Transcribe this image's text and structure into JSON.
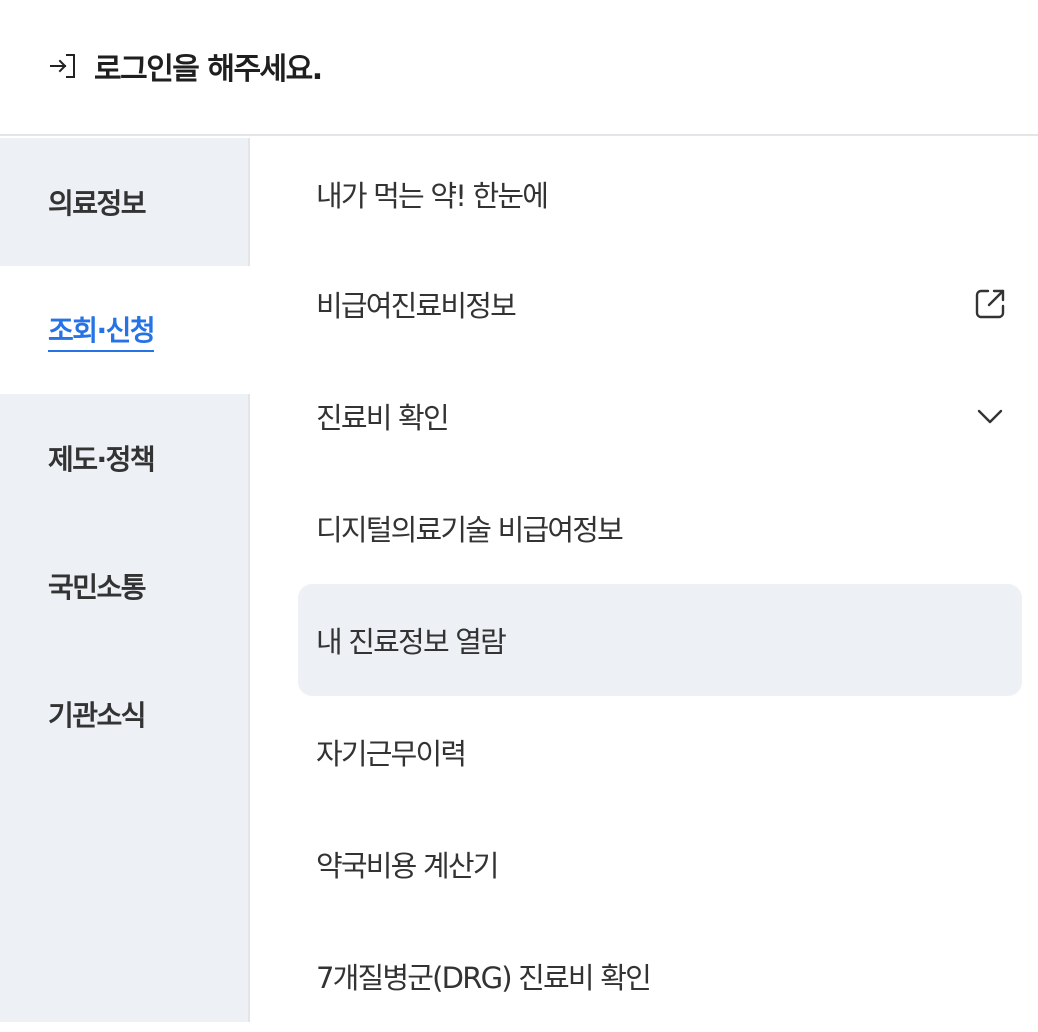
{
  "header": {
    "login_text": "로그인을 해주세요.",
    "login_icon": "login-arrow-icon"
  },
  "sidebar": {
    "active_color": "#2673e5",
    "items": [
      {
        "label": "의료정보",
        "active": false
      },
      {
        "label": "조회·신청",
        "active": true
      },
      {
        "label": "제도·정책",
        "active": false
      },
      {
        "label": "국민소통",
        "active": false
      },
      {
        "label": "기관소식",
        "active": false
      }
    ]
  },
  "menu": {
    "items": [
      {
        "label": "내가 먹는 약! 한눈에"
      },
      {
        "label": "비급여진료비정보",
        "icon": "external-link-icon"
      },
      {
        "label": "진료비 확인",
        "icon": "chevron-down-icon"
      },
      {
        "label": "디지털의료기술 비급여정보"
      },
      {
        "label": "내 진료정보 열람",
        "highlighted": true
      },
      {
        "label": "자기근무이력"
      },
      {
        "label": "약국비용 계산기"
      },
      {
        "label": "7개질병군(DRG) 진료비 확인"
      }
    ]
  }
}
